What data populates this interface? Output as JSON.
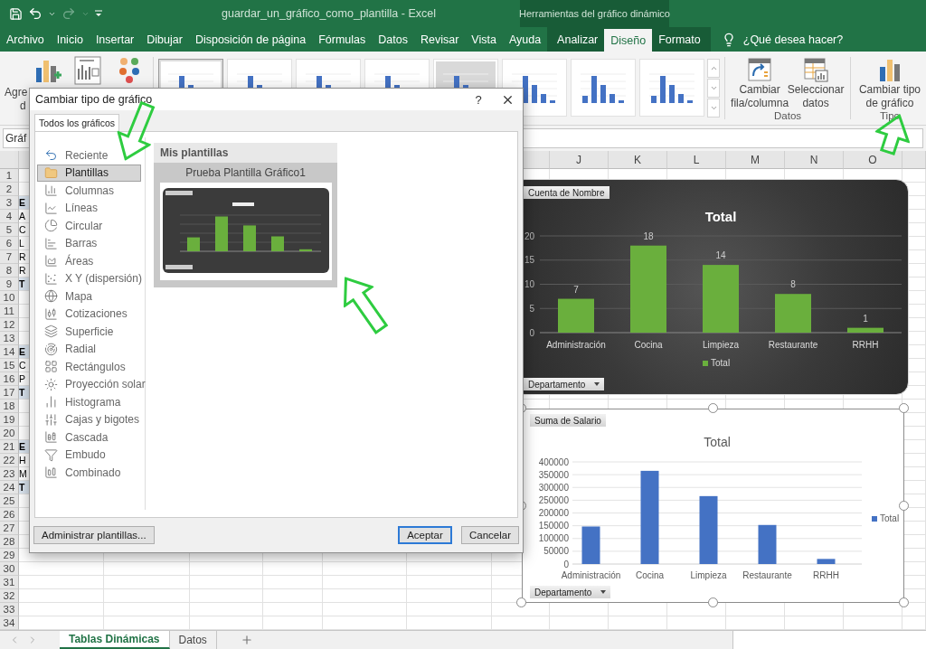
{
  "title_bar": {
    "title": "guardar_un_gráfico_como_plantilla  -  Excel",
    "context_title": "Herramientas del gráfico dinámico"
  },
  "menu_tabs": [
    {
      "label": "Archivo",
      "selected": false,
      "context": false
    },
    {
      "label": "Inicio",
      "selected": false,
      "context": false
    },
    {
      "label": "Insertar",
      "selected": false,
      "context": false
    },
    {
      "label": "Dibujar",
      "selected": false,
      "context": false
    },
    {
      "label": "Disposición de página",
      "selected": false,
      "context": false
    },
    {
      "label": "Fórmulas",
      "selected": false,
      "context": false
    },
    {
      "label": "Datos",
      "selected": false,
      "context": false
    },
    {
      "label": "Revisar",
      "selected": false,
      "context": false
    },
    {
      "label": "Vista",
      "selected": false,
      "context": false
    },
    {
      "label": "Ayuda",
      "selected": false,
      "context": false
    },
    {
      "label": "Analizar",
      "selected": false,
      "context": true
    },
    {
      "label": "Diseño",
      "selected": true,
      "context": true
    },
    {
      "label": "Formato",
      "selected": false,
      "context": true
    }
  ],
  "tell_me": {
    "placeholder": "¿Qué desea hacer?"
  },
  "ribbon": {
    "add_element": {
      "label_lines": [
        "Agre",
        "d"
      ]
    },
    "chart_styles": [
      {
        "selected": true,
        "kind": "light"
      },
      {
        "selected": false,
        "kind": "light"
      },
      {
        "selected": false,
        "kind": "light"
      },
      {
        "selected": false,
        "kind": "light"
      },
      {
        "selected": false,
        "kind": "dark"
      },
      {
        "selected": false,
        "kind": "light"
      },
      {
        "selected": false,
        "kind": "light"
      },
      {
        "selected": false,
        "kind": "light"
      }
    ],
    "groups": [
      {
        "name": "Datos",
        "buttons": [
          {
            "label_lines": [
              "Cambiar",
              "fila/columna"
            ],
            "kind": "switch"
          },
          {
            "label_lines": [
              "Seleccionar",
              "datos"
            ],
            "kind": "select"
          }
        ]
      },
      {
        "name": "Tipo",
        "buttons": [
          {
            "label_lines": [
              "Cambiar tipo",
              "de gráfico"
            ],
            "kind": "change_type"
          }
        ]
      }
    ]
  },
  "name_box": {
    "value": "Gráf"
  },
  "sheet": {
    "columns": [
      "J",
      "K",
      "L",
      "M",
      "N",
      "O"
    ],
    "rows": [
      {
        "number": "1",
        "header": false
      },
      {
        "number": "2",
        "header": false
      },
      {
        "number": "3",
        "header": true,
        "cell": "E"
      },
      {
        "number": "4",
        "header": false,
        "cell": "A"
      },
      {
        "number": "5",
        "header": false,
        "cell": "C"
      },
      {
        "number": "6",
        "header": false,
        "cell": "L"
      },
      {
        "number": "7",
        "header": false,
        "cell": "R"
      },
      {
        "number": "8",
        "header": false,
        "cell": "R"
      },
      {
        "number": "9",
        "header": true,
        "cell": "T"
      },
      {
        "number": "10",
        "header": false
      },
      {
        "number": "11",
        "header": false
      },
      {
        "number": "12",
        "header": false
      },
      {
        "number": "13",
        "header": false
      },
      {
        "number": "14",
        "header": true,
        "cell": "E"
      },
      {
        "number": "15",
        "header": false,
        "cell": "C"
      },
      {
        "number": "16",
        "header": false,
        "cell": "P"
      },
      {
        "number": "17",
        "header": true,
        "cell": "T"
      },
      {
        "number": "18",
        "header": false
      },
      {
        "number": "19",
        "header": false
      },
      {
        "number": "20",
        "header": false
      },
      {
        "number": "21",
        "header": true,
        "cell": "E"
      },
      {
        "number": "22",
        "header": false,
        "cell": "H"
      },
      {
        "number": "23",
        "header": false,
        "cell": "M"
      },
      {
        "number": "24",
        "header": true,
        "cell": "T"
      },
      {
        "number": "25",
        "header": false
      },
      {
        "number": "26",
        "header": false
      },
      {
        "number": "27",
        "header": false
      },
      {
        "number": "28",
        "header": false
      },
      {
        "number": "29",
        "header": false
      },
      {
        "number": "30",
        "header": false
      },
      {
        "number": "31",
        "header": false
      },
      {
        "number": "32",
        "header": false
      },
      {
        "number": "33",
        "header": false
      },
      {
        "number": "34",
        "header": false
      }
    ]
  },
  "charts": [
    {
      "kind": "dark",
      "selected": false,
      "value_field": "Cuenta de Nombre",
      "axis_field": "Departamento",
      "chart_data": {
        "type": "bar",
        "title": "Total",
        "categories": [
          "Administración",
          "Cocina",
          "Limpieza",
          "Restaurante",
          "RRHH"
        ],
        "series": [
          {
            "name": "Total",
            "color": "#6aaf3d",
            "values": [
              7,
              18,
              14,
              8,
              1
            ]
          }
        ],
        "ylim": [
          0,
          20
        ],
        "yticks": [
          0,
          5,
          10,
          15,
          20
        ],
        "grid": true,
        "data_labels": true
      }
    },
    {
      "kind": "light",
      "selected": true,
      "value_field": "Suma de Salario",
      "axis_field": "Departamento",
      "chart_data": {
        "type": "bar",
        "title": "Total",
        "categories": [
          "Administración",
          "Cocina",
          "Limpieza",
          "Restaurante",
          "RRHH"
        ],
        "series": [
          {
            "name": "Total",
            "color": "#4472c4",
            "values": [
              147000,
              365000,
              266000,
              153000,
              20000
            ]
          }
        ],
        "ylim": [
          0,
          400000
        ],
        "yticks": [
          0,
          50000,
          100000,
          150000,
          200000,
          250000,
          300000,
          350000,
          400000
        ],
        "grid": true
      }
    }
  ],
  "dialog": {
    "title": "Cambiar tipo de gráfico",
    "help": "?",
    "tabs": [
      {
        "label": "Todos los gráficos",
        "selected": true
      }
    ],
    "chart_types": [
      {
        "label": "Reciente",
        "kind": "recent",
        "selected": false
      },
      {
        "label": "Plantillas",
        "kind": "templates",
        "selected": true
      },
      {
        "label": "Columnas",
        "kind": "column",
        "selected": false
      },
      {
        "label": "Líneas",
        "kind": "line",
        "selected": false
      },
      {
        "label": "Circular",
        "kind": "pie",
        "selected": false
      },
      {
        "label": "Barras",
        "kind": "bar",
        "selected": false
      },
      {
        "label": "Áreas",
        "kind": "area",
        "selected": false
      },
      {
        "label": "X Y (dispersión)",
        "kind": "scatter",
        "selected": false
      },
      {
        "label": "Mapa",
        "kind": "map",
        "selected": false
      },
      {
        "label": "Cotizaciones",
        "kind": "stock",
        "selected": false
      },
      {
        "label": "Superficie",
        "kind": "surface",
        "selected": false
      },
      {
        "label": "Radial",
        "kind": "radar",
        "selected": false
      },
      {
        "label": "Rectángulos",
        "kind": "treemap",
        "selected": false
      },
      {
        "label": "Proyección solar",
        "kind": "sunburst",
        "selected": false
      },
      {
        "label": "Histograma",
        "kind": "histogram",
        "selected": false
      },
      {
        "label": "Cajas y bigotes",
        "kind": "box",
        "selected": false
      },
      {
        "label": "Cascada",
        "kind": "waterfall",
        "selected": false
      },
      {
        "label": "Embudo",
        "kind": "funnel",
        "selected": false
      },
      {
        "label": "Combinado",
        "kind": "combo",
        "selected": false
      }
    ],
    "templates_header": "Mis plantillas",
    "templates": [
      {
        "name": "Prueba Plantilla Gráfico1",
        "selected": true
      }
    ],
    "buttons": [
      {
        "label": "Administrar plantillas...",
        "kind": "manage"
      },
      {
        "label": "Aceptar",
        "kind": "default"
      },
      {
        "label": "Cancelar",
        "kind": "normal"
      }
    ]
  },
  "sheet_tabs": [
    {
      "label": "Tablas Dinámicas",
      "selected": true
    },
    {
      "label": "Datos",
      "selected": false
    }
  ]
}
